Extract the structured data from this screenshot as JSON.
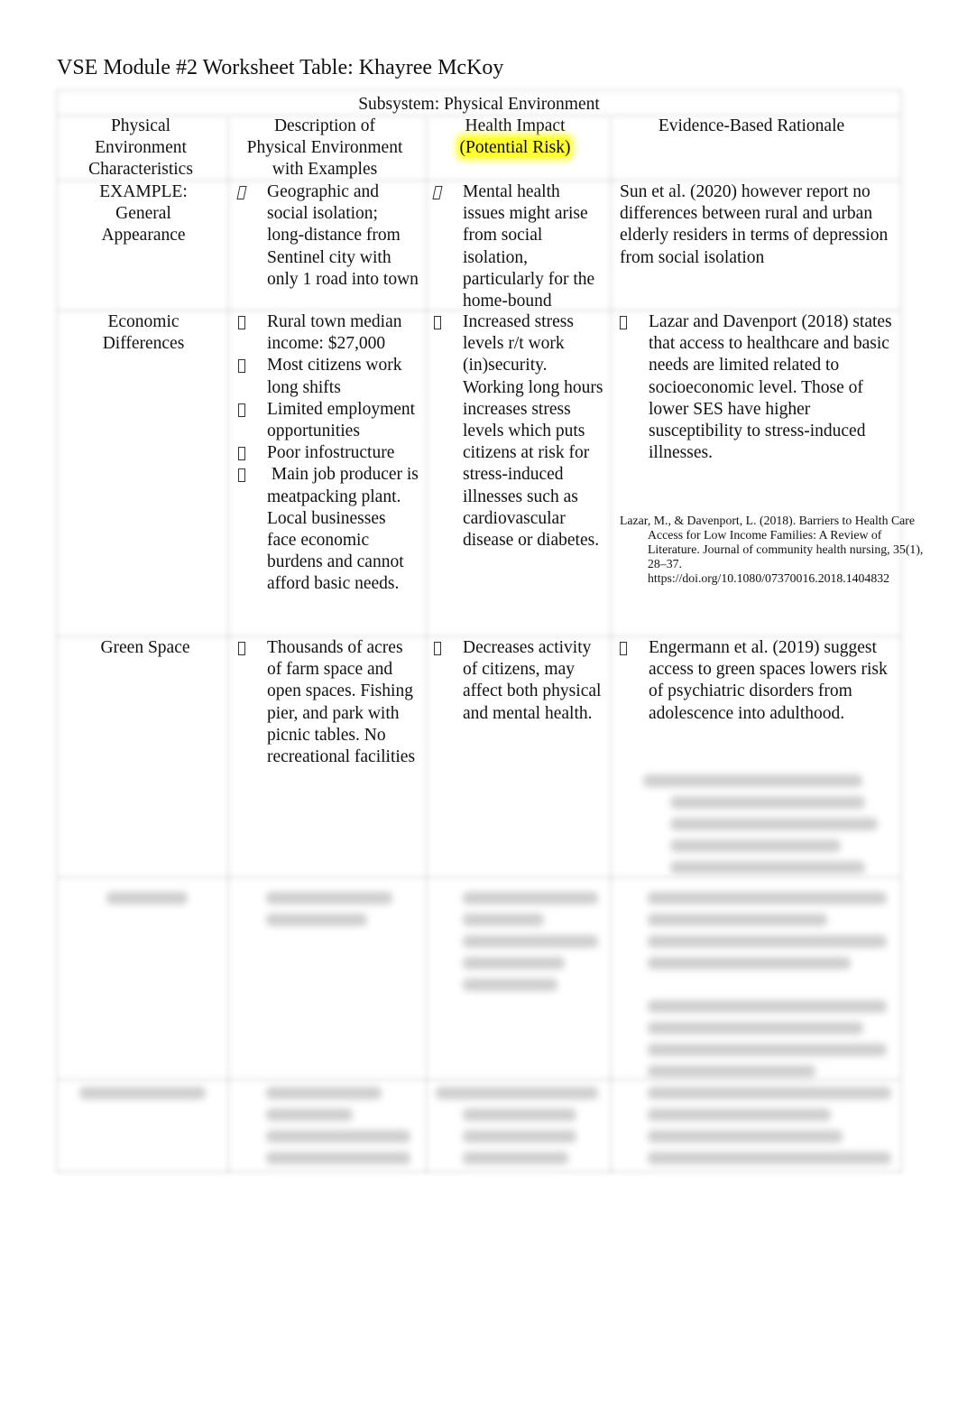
{
  "document": {
    "title": "VSE Module #2 Worksheet Table: Khayree McKoy"
  },
  "table": {
    "subsystem_label": "Subsystem: Physical Environment",
    "headers": {
      "col1": [
        "Physical",
        "Environment",
        "Characteristics"
      ],
      "col2": [
        "Description of",
        "Physical Environment",
        "with Examples"
      ],
      "col3_line1": "Health Impact",
      "col3_line2_highlighted": "(Potential Risk)",
      "col4": "Evidence-Based Rationale"
    },
    "highlight_color": "#ffff33",
    "rows": [
      {
        "characteristic": [
          "EXAMPLE:",
          "General",
          "Appearance"
        ],
        "description_bullets": [
          "Geographic and social isolation; long-distance from Sentinel city with only 1 road into town"
        ],
        "impact_bullets": [
          "Mental health issues might arise from social isolation, particularly for the home-bound"
        ],
        "rationale_text": "Sun et al. (2020) however report no differences between rural and urban elderly residers in terms of depression from social isolation"
      },
      {
        "characteristic": [
          "Economic",
          "Differences"
        ],
        "description_bullets": [
          "Rural town median income: $27,000",
          "Most citizens work long shifts",
          "Limited employment opportunities",
          "Poor infostructure",
          " Main job producer is meatpacking plant. Local businesses face economic burdens and cannot afford basic needs."
        ],
        "impact_bullets": [
          "Increased stress levels r/t work (in)security. Working long hours increases stress levels which puts citizens at risk for stress-induced illnesses such as cardiovascular disease or diabetes."
        ],
        "rationale_bullets": [
          "Lazar and Davenport (2018) states that access to healthcare and basic needs are limited related to socioeconomic level. Those of lower SES have higher susceptibility to stress-induced illnesses."
        ],
        "reference": "Lazar, M., & Davenport, L. (2018). Barriers to Health Care Access for Low Income Families: A Review of Literature. Journal of community health nursing, 35(1), 28–37. https://doi.org/10.1080/07370016.2018.1404832"
      },
      {
        "characteristic": [
          "Green Space"
        ],
        "description_bullets": [
          "Thousands of acres of farm space and open spaces. Fishing pier, and park with picnic tables. No recreational facilities"
        ],
        "impact_bullets": [
          "Decreases activity of citizens, may affect both physical and mental health."
        ],
        "rationale_bullets": [
          "Engermann et al. (2019) suggest access to green spaces lowers risk of psychiatric disorders from adolescence into adulthood."
        ]
      }
    ],
    "blurred_rows_note": "Remaining rows are blurred/illegible in the screenshot"
  }
}
